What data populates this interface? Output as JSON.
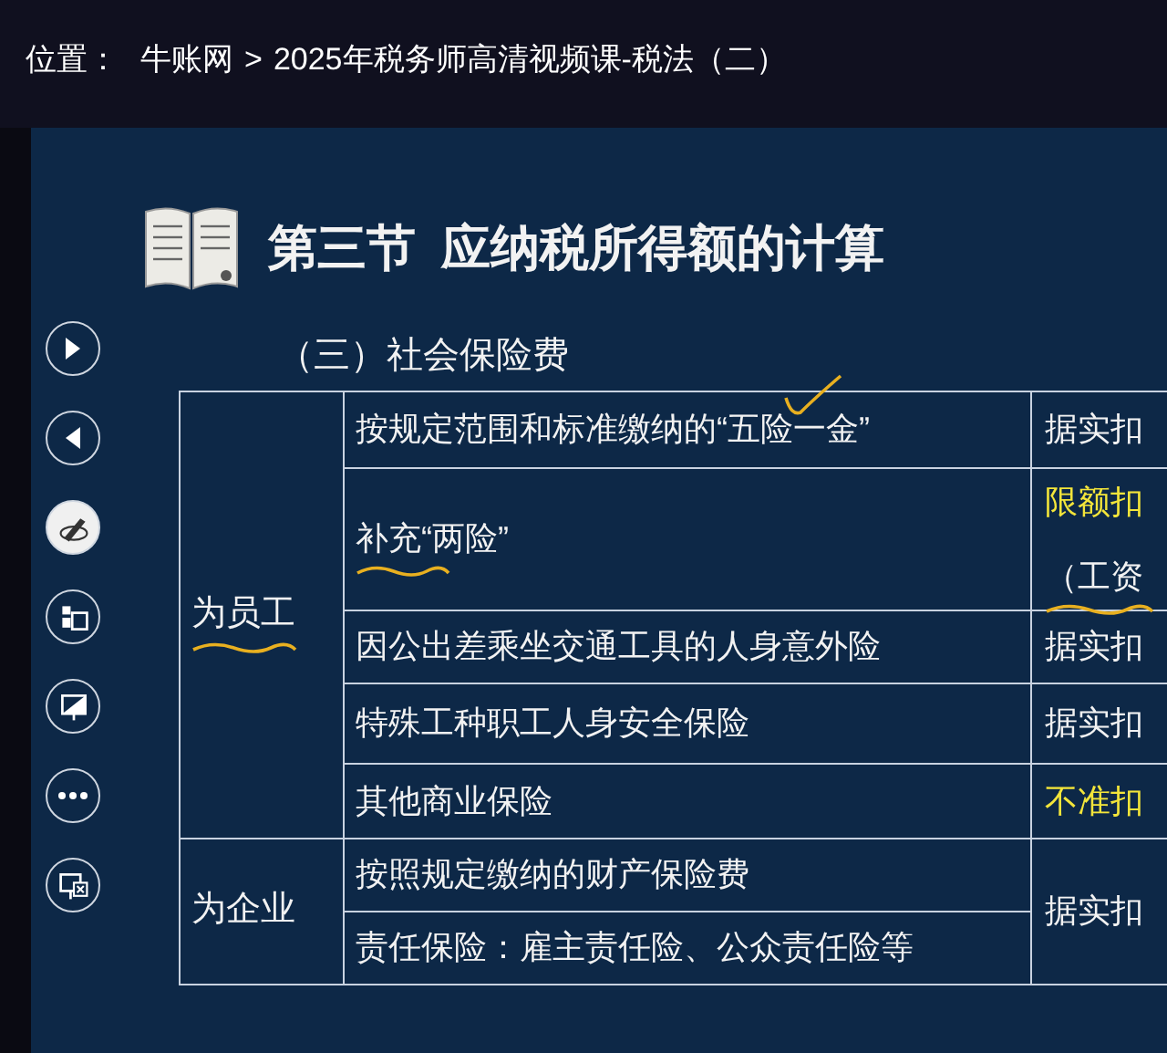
{
  "breadcrumb": {
    "label": "位置：",
    "items": [
      "牛账网",
      "2025年税务师高清视频课-税法（二）"
    ],
    "separator": ">"
  },
  "slide": {
    "section": "第三节",
    "title": "应纳税所得额的计算",
    "subtitle": "（三）社会保险费",
    "controls": [
      {
        "kind": "next",
        "selected": false
      },
      {
        "kind": "previous",
        "selected": false
      },
      {
        "kind": "pen",
        "selected": true
      },
      {
        "kind": "slides",
        "selected": false
      },
      {
        "kind": "pointer",
        "selected": false
      },
      {
        "kind": "more",
        "selected": false
      },
      {
        "kind": "exit",
        "selected": false
      }
    ],
    "table": {
      "groups": [
        {
          "label": "为员工",
          "ink_underline": true,
          "rows": [
            {
              "item": "按规定范围和标准缴纳的“五险一金”",
              "ink_check": true,
              "result": [
                {
                  "text": "据实扣",
                  "highlight": false
                }
              ]
            },
            {
              "item": "补充“两险”",
              "ink_underline": true,
              "result": [
                {
                  "text": "限额扣",
                  "highlight": true
                },
                {
                  "text": "（工资",
                  "highlight": false,
                  "ink_underline": true
                }
              ]
            },
            {
              "item": "因公出差乘坐交通工具的人身意外险",
              "result": [
                {
                  "text": "据实扣",
                  "highlight": false
                }
              ]
            },
            {
              "item": "特殊工种职工人身安全保险",
              "result": [
                {
                  "text": "据实扣",
                  "highlight": false
                }
              ]
            },
            {
              "item": "其他商业保险",
              "result": [
                {
                  "text": "不准扣",
                  "highlight": true
                }
              ]
            }
          ]
        },
        {
          "label": "为企业",
          "result": [
            {
              "text": "据实扣",
              "highlight": false
            }
          ],
          "rows": [
            {
              "item": "按照规定缴纳的财产保险费"
            },
            {
              "item": "责任保险：雇主责任险、公众责任险等"
            }
          ]
        }
      ]
    }
  }
}
